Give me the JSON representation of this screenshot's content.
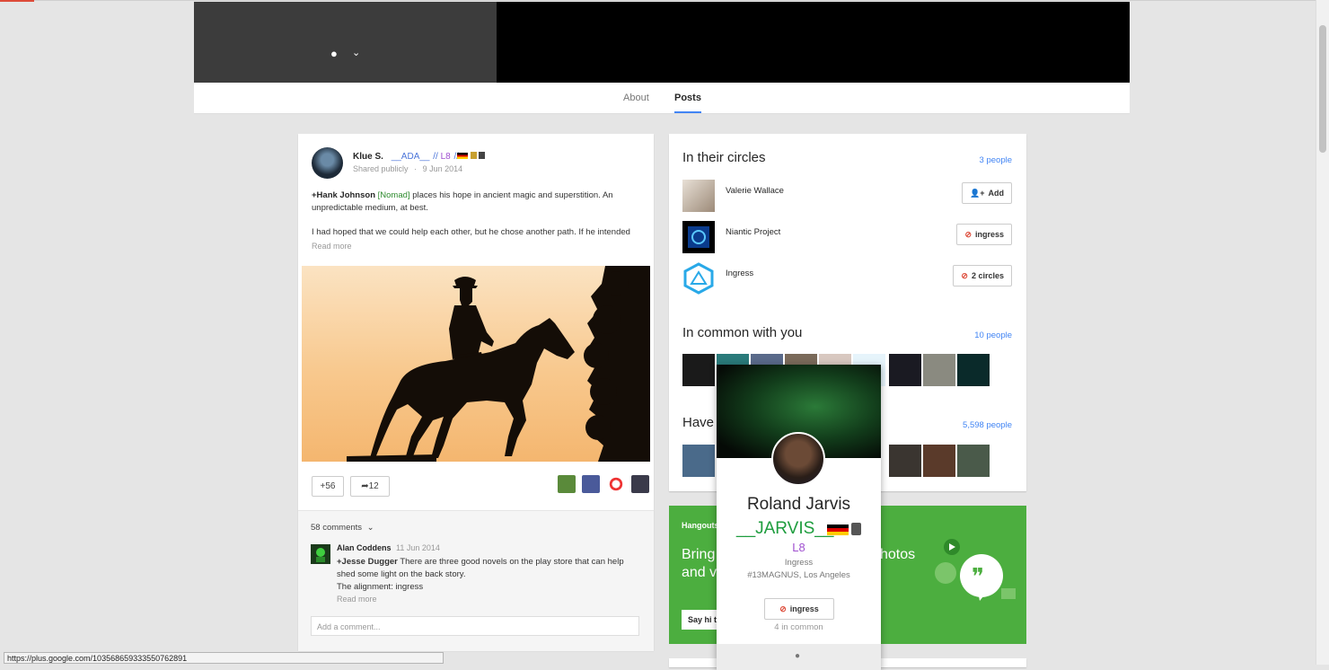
{
  "cover": {
    "location_icon": "pin-icon"
  },
  "tabs": [
    {
      "label": "About"
    },
    {
      "label": "Posts"
    }
  ],
  "post": {
    "author": "Klue S.",
    "tag": "__ADA__",
    "sep1": "//",
    "level": "L8",
    "sep2": "//",
    "visibility": "Shared publicly",
    "dot": "·",
    "date": "9 Jun 2014",
    "mention": "+Hank Johnson",
    "faction_open": "[",
    "faction": "Nomad",
    "faction_close": "]",
    "text_rest": "places his hope in ancient magic and superstition. An unpredictable medium, at best.",
    "text2": "I had hoped that we could help each other, but he chose another path. If he intended",
    "read_more": "Read more",
    "plus_count": "+56",
    "share_count": "12",
    "comments_count": "58 comments",
    "comment": {
      "author": "Alan Coddens",
      "date": "11 Jun 2014",
      "mention": "+Jesse Dugger",
      "text": "There are three good novels on the play store that can help shed some light on the back story.",
      "text2": "The alignment: ingress",
      "read_more": "Read more"
    },
    "comment_placeholder": "Add a comment..."
  },
  "circles": {
    "title": "In their circles",
    "link": "3 people",
    "rows": [
      {
        "name": "Valerie Wallace",
        "button": "Add"
      },
      {
        "name": "Niantic Project",
        "button": "ingress"
      },
      {
        "name": "Ingress",
        "button": "2 circles"
      }
    ]
  },
  "common": {
    "title": "In common with you",
    "link": "10 people"
  },
  "have": {
    "title": "Have",
    "link": "5,598 people"
  },
  "hangouts": {
    "label": "Hangouts",
    "line1": "Bring",
    "line2": "and vi",
    "right": "hotos",
    "button": "Say hi to"
  },
  "hovercard": {
    "name": "Roland Jarvis",
    "nick": "__JARVIS__",
    "level": "L8",
    "faction": "Ingress",
    "location": "#13MAGNUS, Los Angeles",
    "button": "ingress",
    "in_common": "4 in common"
  },
  "status_url": "https://plus.google.com/103568659333550762891",
  "colors": {
    "accent": "#4285f4",
    "green": "#4cae3f",
    "red": "#dd4b39",
    "purple": "#a050d0"
  }
}
